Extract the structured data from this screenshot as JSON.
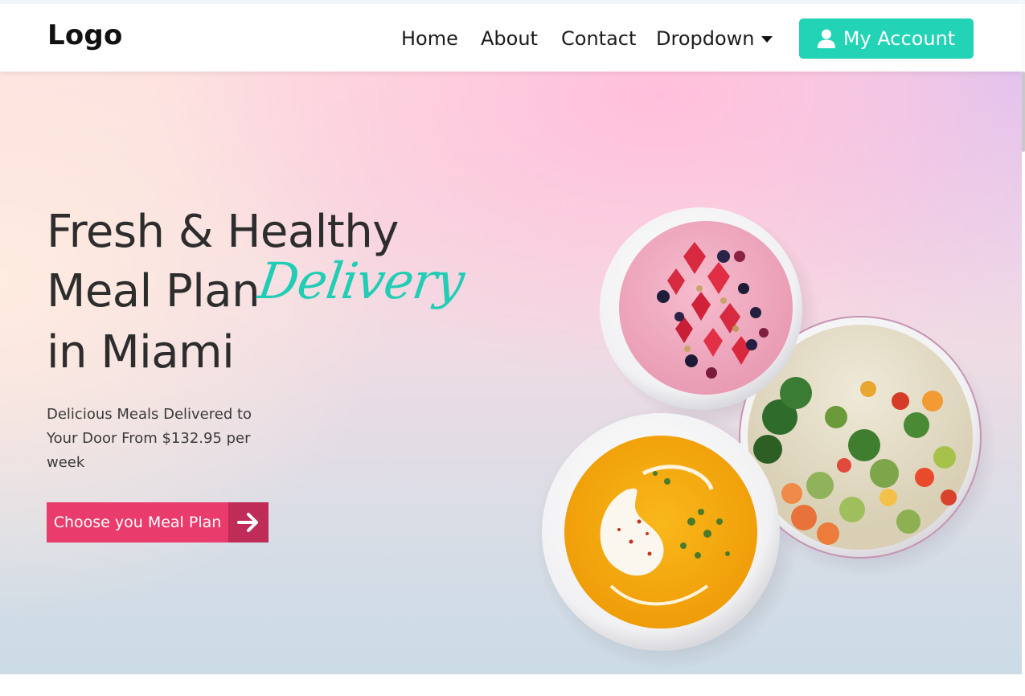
{
  "header": {
    "logo": "Logo",
    "nav": [
      "Home",
      "About",
      "Contact",
      "Dropdown"
    ],
    "account_label": "My Account",
    "icons": {
      "account": "user-icon",
      "dropdown": "caret-down-icon"
    }
  },
  "hero": {
    "title_line1": "Fresh & Healthy",
    "title_line2": "Meal Plan",
    "title_script": "Delivery",
    "title_line3": "in Miami",
    "subtitle": "Delicious Meals Delivered to Your Door From $132.95 per week",
    "cta_label": "Choose you Meal Plan",
    "cta_icon": "arrow-right-icon"
  },
  "colors": {
    "accent_teal": "#22d3b5",
    "cta_pink": "#e93b6c",
    "cta_pink_dark": "#bf2c57"
  }
}
